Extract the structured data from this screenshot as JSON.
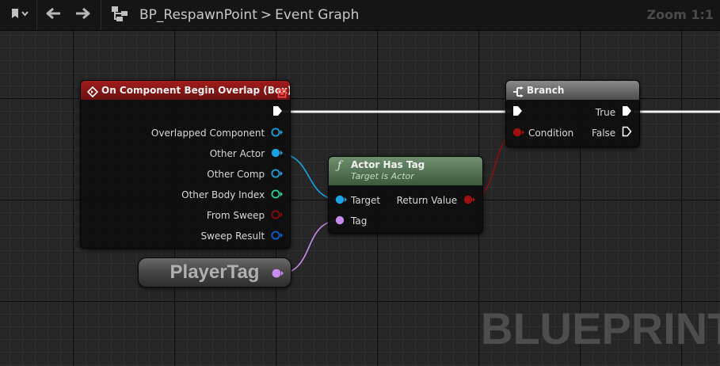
{
  "toolbar": {
    "breadcrumb": {
      "asset": "BP_RespawnPoint",
      "separator": ">",
      "graph": "Event Graph"
    },
    "zoom": "Zoom 1:1"
  },
  "nodes": {
    "overlap_event": {
      "title": "On Component Begin Overlap (Box)",
      "header_color": "#7a1616",
      "pins": [
        {
          "label": "Overlapped Component",
          "color": "#1aa3e0",
          "connected": false
        },
        {
          "label": "Other Actor",
          "color": "#1aa3e0",
          "connected": true
        },
        {
          "label": "Other Comp",
          "color": "#1aa3e0",
          "connected": false
        },
        {
          "label": "Other Body Index",
          "color": "#22d6a0",
          "connected": false
        },
        {
          "label": "From Sweep",
          "color": "#8a0b0b",
          "connected": false
        },
        {
          "label": "Sweep Result",
          "color": "#0b5fd1",
          "connected": false
        }
      ]
    },
    "actor_has_tag": {
      "title": "Actor Has Tag",
      "subtitle": "Target is Actor",
      "header_color": "#4e6e4e",
      "inputs": [
        {
          "label": "Target",
          "color": "#1aa3e0"
        },
        {
          "label": "Tag",
          "color": "#c78cf0"
        }
      ],
      "output": {
        "label": "Return Value",
        "color": "#a01010"
      }
    },
    "branch": {
      "title": "Branch",
      "input_label": "Condition",
      "input_color": "#a01010",
      "outputs": [
        "True",
        "False"
      ]
    },
    "variable": {
      "label": "PlayerTag",
      "pin_color": "#c78cf0"
    }
  },
  "watermark": "BLUEPRINT"
}
